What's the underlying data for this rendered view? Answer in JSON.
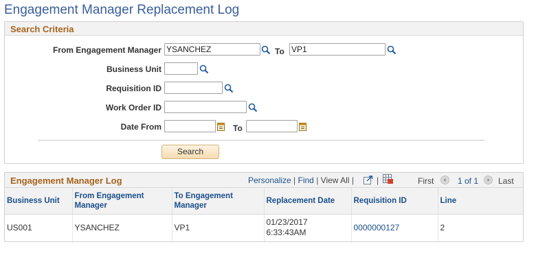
{
  "page": {
    "title": "Engagement Manager Replacement Log"
  },
  "search_criteria": {
    "header": "Search Criteria",
    "from_manager_label": "From Engagement Manager",
    "from_manager_value": "YSANCHEZ",
    "to_label": "To",
    "to_manager_value": "VP1",
    "business_unit_label": "Business Unit",
    "business_unit_value": "",
    "requisition_id_label": "Requisition ID",
    "requisition_id_value": "",
    "work_order_id_label": "Work Order ID",
    "work_order_id_value": "",
    "date_from_label": "Date From",
    "date_from_value": "",
    "date_to_label": "To",
    "date_to_value": "",
    "search_button": "Search"
  },
  "log": {
    "header": "Engagement Manager Log",
    "nav": {
      "personalize": "Personalize",
      "find": "Find",
      "view_all": "View All",
      "first": "First",
      "range": "1 of 1",
      "last": "Last"
    },
    "columns": [
      "Business Unit",
      "From Engagement Manager",
      "To Engagement Manager",
      "Replacement Date",
      "Requisition ID",
      "Line"
    ],
    "rows": [
      {
        "business_unit": "US001",
        "from_manager": "YSANCHEZ",
        "to_manager": "VP1",
        "replacement_date": "01/23/2017",
        "replacement_time": "6:33:43AM",
        "requisition_id": "0000000127",
        "line": "2"
      }
    ]
  },
  "icons": {
    "lookup": "magnifier-icon",
    "calendar": "calendar-icon",
    "new_window": "new-window-icon",
    "download": "grid-download-icon",
    "prev": "previous-arrow-icon",
    "next": "next-arrow-icon"
  },
  "colors": {
    "title": "#3a5d9b",
    "group_header": "#a6631d",
    "link": "#1a4f8a",
    "button": "#f6dcb0"
  }
}
